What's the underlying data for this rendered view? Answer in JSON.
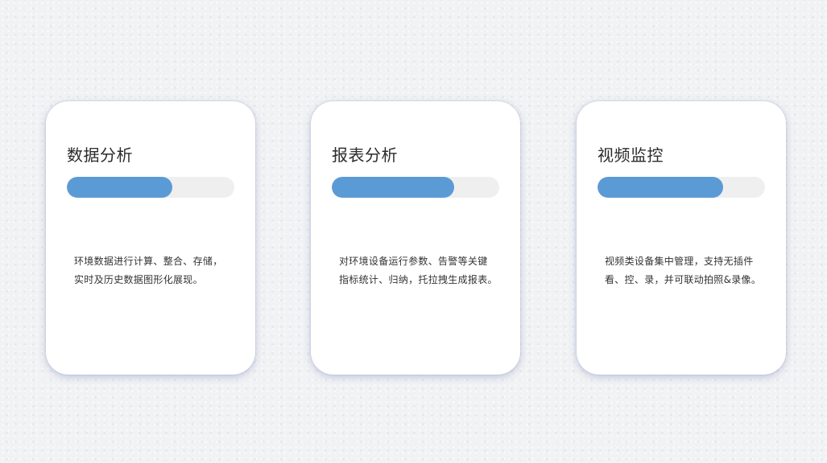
{
  "colors": {
    "background": "#f1f2f4",
    "card": "#ffffff",
    "progress_fill": "#5b9bd5",
    "progress_track": "#efefef",
    "title_text": "#2b2b2b",
    "body_text": "#333333"
  },
  "cards": [
    {
      "title": "数据分析",
      "progress": 0.63,
      "description": [
        "环境数据进行计算、整合、存储，",
        "实时及历史数据图形化展现。"
      ]
    },
    {
      "title": "报表分析",
      "progress": 0.73,
      "description": [
        "对环境设备运行参数、告警等关键",
        "指标统计、归纳，托拉拽生成报表。"
      ]
    },
    {
      "title": "视频监控",
      "progress": 0.75,
      "description": [
        "视频类设备集中管理，支持无插件",
        "看、控、录，并可联动拍照&录像。"
      ]
    }
  ]
}
